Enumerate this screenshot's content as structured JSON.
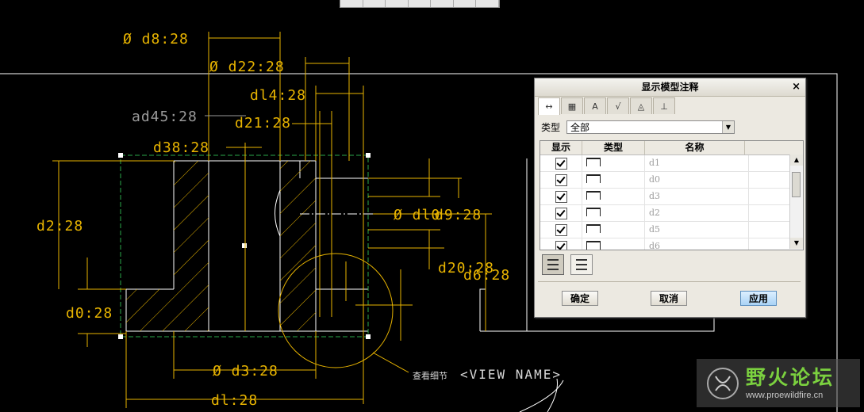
{
  "drawing": {
    "dims": {
      "d8": "Ø d8:28",
      "d22": "Ø d22:28",
      "d14": "dl4:28",
      "ad45": "ad45:28",
      "d21": "d21:28",
      "d38": "d38:28",
      "d2": "d2:28",
      "d10": "Ø dl0",
      "d9": "d9:28",
      "d20": "d20:28",
      "d6": "d6:28",
      "d0": "d0:28",
      "d3": "Ø d3:28",
      "d1": "dl:28"
    },
    "detail_label": "查看细节",
    "view_name": "<VIEW NAME>"
  },
  "dialog": {
    "title": "显示模型注释",
    "close": "×",
    "type_label": "类型",
    "type_value": "全部",
    "columns": [
      "显示",
      "类型",
      "名称"
    ],
    "rows": [
      {
        "name": "d1"
      },
      {
        "name": "d0"
      },
      {
        "name": "d3"
      },
      {
        "name": "d2"
      },
      {
        "name": "d5"
      },
      {
        "name": "d6"
      }
    ],
    "buttons": {
      "ok": "确定",
      "cancel": "取消",
      "apply": "应用"
    }
  },
  "watermark": {
    "title": "野火论坛",
    "url": "www.proewildfire.cn"
  },
  "colors": {
    "dimension": "#e8b400",
    "geometry": "#ffffff",
    "dialog_bg": "#ece9e1",
    "watermark_green": "#7bd13f"
  }
}
